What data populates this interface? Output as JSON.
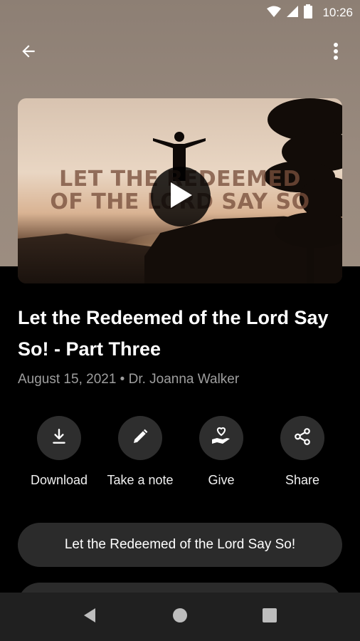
{
  "status": {
    "time": "10:26"
  },
  "hero": {
    "title_line1": "LET THE REDEEMED",
    "title_line2": "OF THE LORD SAY SO"
  },
  "episode": {
    "title": "Let the Redeemed of the Lord Say So! - Part Three",
    "date": "August 15, 2021",
    "separator": "•",
    "speaker": "Dr. Joanna Walker"
  },
  "actions": [
    {
      "label": "Download",
      "icon": "download-icon"
    },
    {
      "label": "Take a note",
      "icon": "pencil-icon"
    },
    {
      "label": "Give",
      "icon": "give-heart-hand-icon"
    },
    {
      "label": "Share",
      "icon": "share-icon"
    }
  ],
  "series_button": {
    "label": "Let the Redeemed of the Lord Say So!"
  },
  "colors": {
    "header_bg": "#998a7e",
    "page_bg": "#000000",
    "button_bg": "#2b2b2b",
    "meta_text": "#9e9e9e"
  }
}
